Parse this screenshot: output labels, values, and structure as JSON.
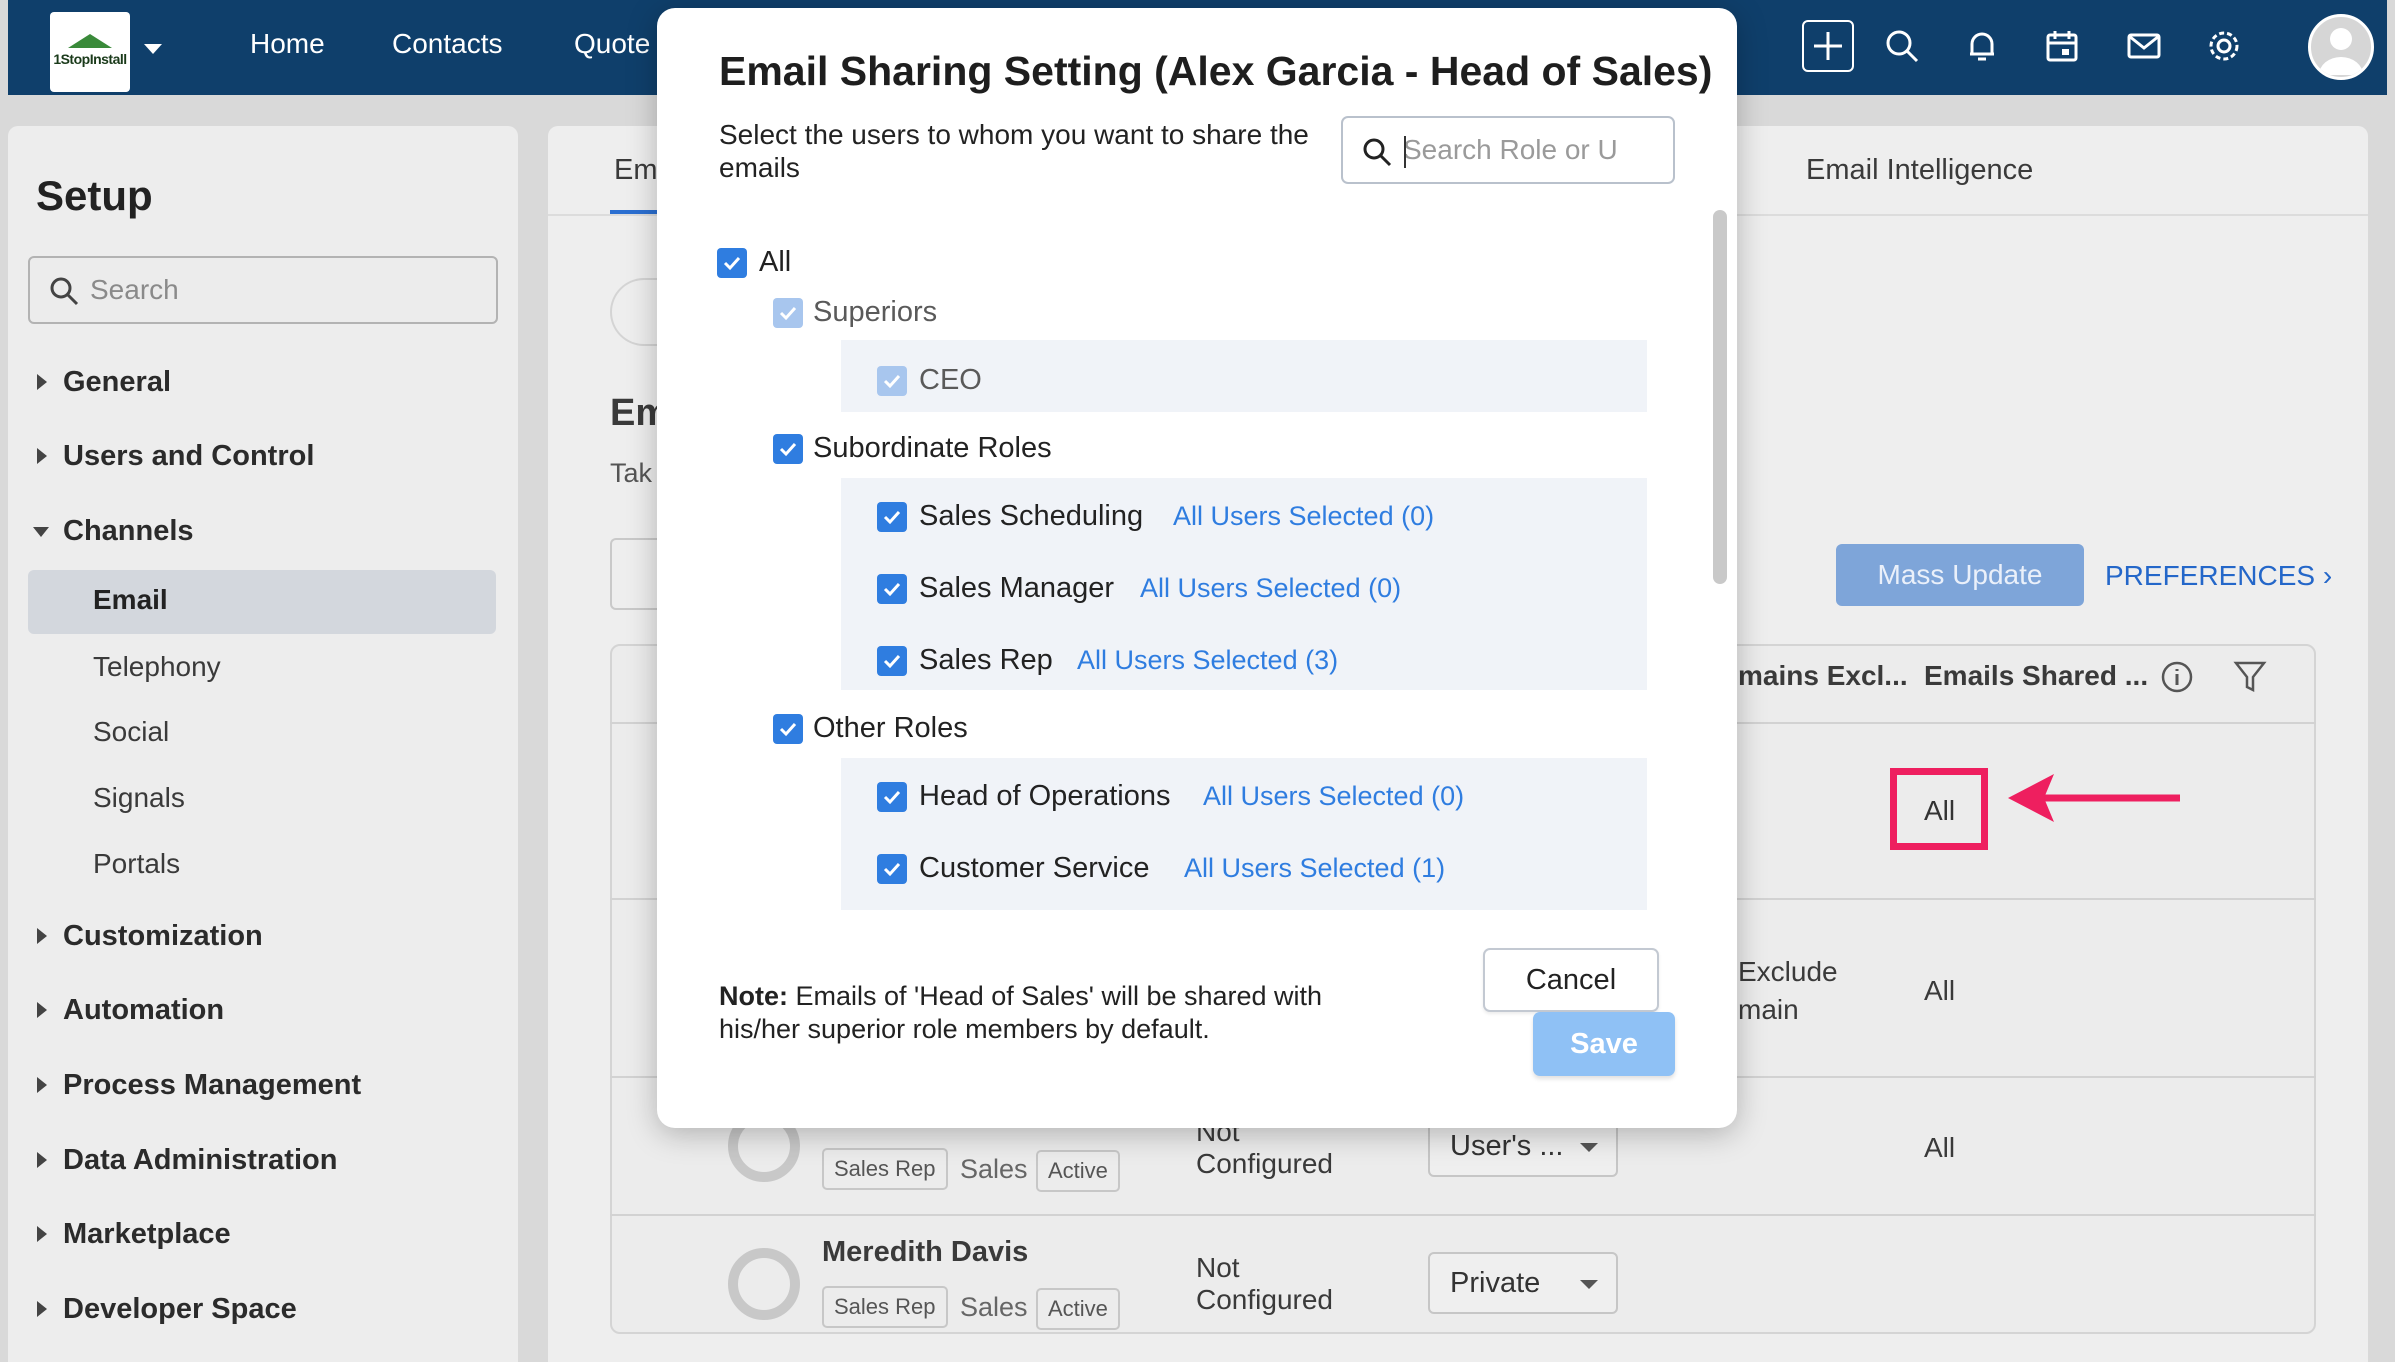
{
  "topbar": {
    "logo_text": "1StopInstall",
    "nav": [
      "Home",
      "Contacts",
      "Quote"
    ]
  },
  "sidebar": {
    "title": "Setup",
    "search_placeholder": "Search",
    "sections": {
      "general": "General",
      "users": "Users and Control",
      "channels": "Channels",
      "customization": "Customization",
      "automation": "Automation",
      "process": "Process Management",
      "data": "Data Administration",
      "marketplace": "Marketplace",
      "developer": "Developer Space"
    },
    "channels_items": [
      "Email",
      "Telephony",
      "Social",
      "Signals",
      "Portals"
    ]
  },
  "main": {
    "tab_partial": "Em",
    "tab_email_intelligence": "Email Intelligence",
    "heading_partial": "Em",
    "subtext_partial": "Tak",
    "mass_update": "Mass Update",
    "preferences": "PREFERENCES",
    "col_domains": "mains Excl...",
    "col_emails_shared": "Emails Shared ...",
    "rows": [
      {
        "emails_shared": "All"
      },
      {
        "domain_line1": "Exclude",
        "domain_line2": "main",
        "emails_shared": "All"
      },
      {
        "role": "Sales Rep",
        "dept": "Sales",
        "status": "Active",
        "config1": "Not",
        "config2": "Configured",
        "dropdown": "User's ...",
        "emails_shared": "All"
      },
      {
        "name": "Meredith Davis",
        "role": "Sales Rep",
        "dept": "Sales",
        "status": "Active",
        "config1": "Not",
        "config2": "Configured",
        "dropdown": "Private"
      }
    ]
  },
  "modal": {
    "title": "Email Sharing Setting (Alex Garcia - Head of Sales)",
    "description": "Select the users to whom you want to share the emails",
    "search_placeholder": "Search Role or U",
    "all_label": "All",
    "superiors_label": "Superiors",
    "ceo_label": "CEO",
    "subordinate_label": "Subordinate Roles",
    "sales_scheduling": "Sales Scheduling",
    "sales_scheduling_link": "All Users Selected (0)",
    "sales_manager": "Sales Manager",
    "sales_manager_link": "All Users Selected (0)",
    "sales_rep": "Sales Rep",
    "sales_rep_link": "All Users Selected (3)",
    "other_label": "Other Roles",
    "head_ops": "Head of Operations",
    "head_ops_link": "All Users Selected (0)",
    "customer_service": "Customer Service",
    "customer_service_link": "All Users Selected (1)",
    "note_bold": "Note:",
    "note_text": " Emails of 'Head of Sales' will be shared with his/her superior role members by default.",
    "cancel": "Cancel",
    "save": "Save"
  },
  "colors": {
    "topbar": "#0f3f6b",
    "checkbox": "#2f7de0",
    "highlight": "#ee1f5f",
    "save": "#8fc1f5"
  }
}
